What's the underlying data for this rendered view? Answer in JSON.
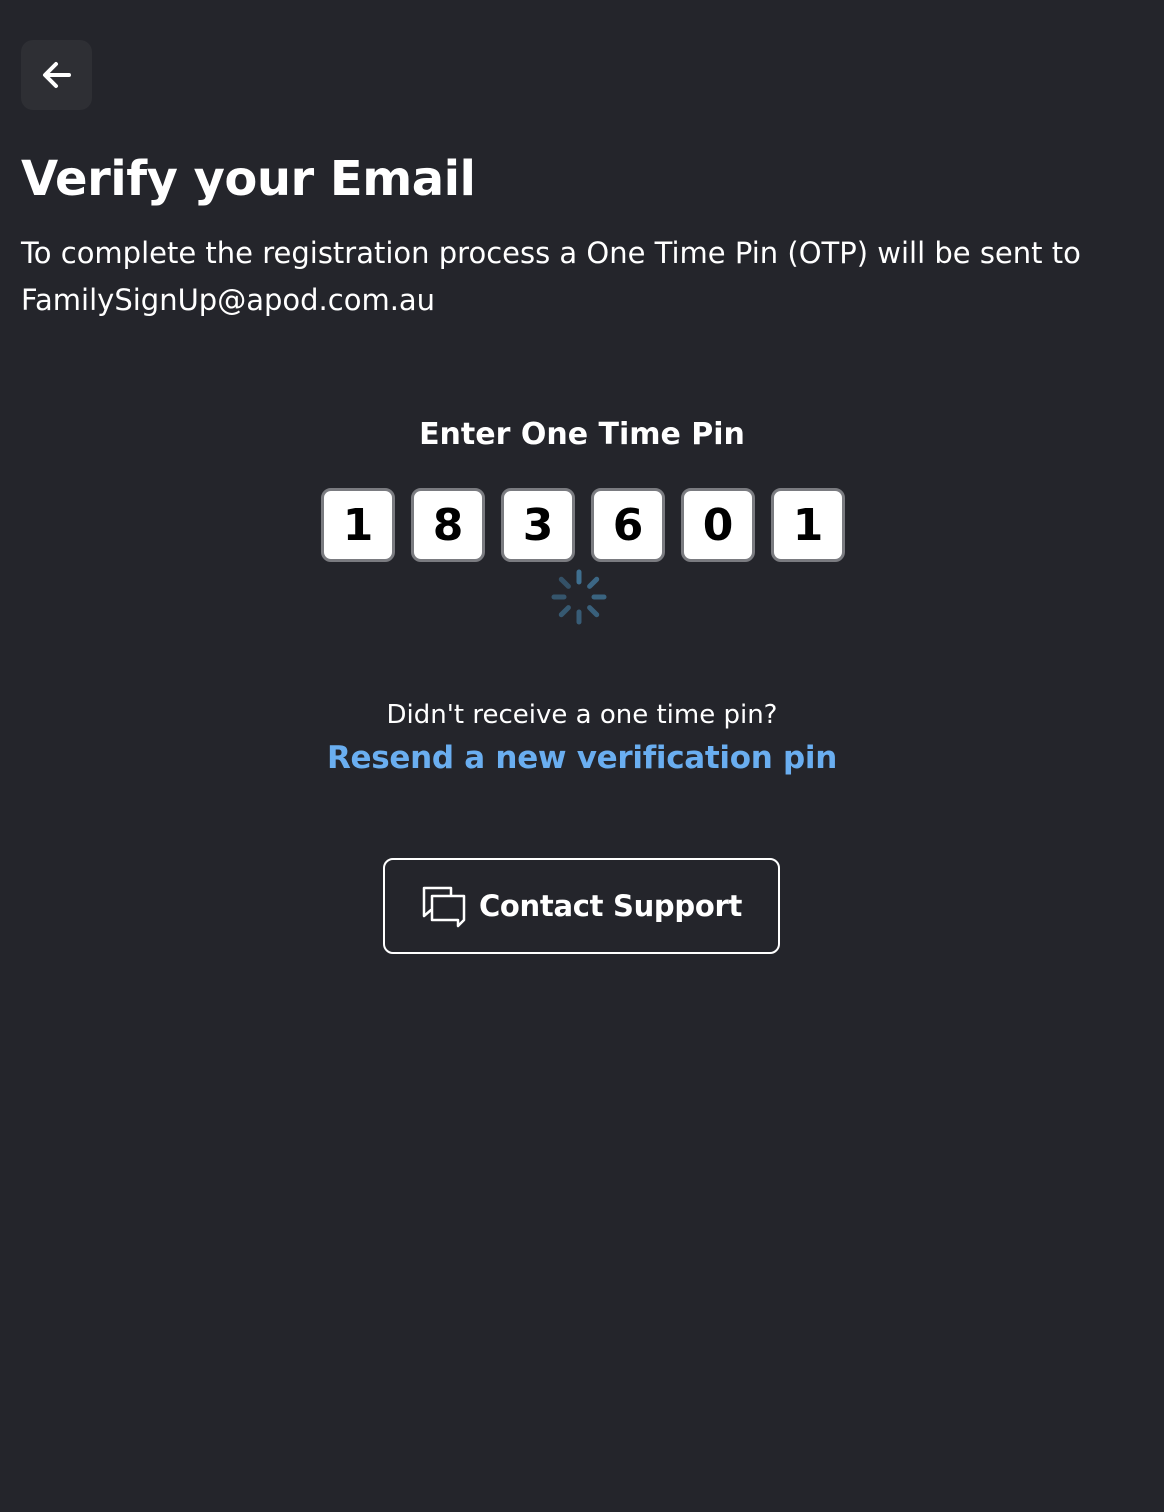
{
  "header": {
    "back_icon": "arrow-left-icon"
  },
  "title": "Verify your Email",
  "description": "To complete the registration process a One Time Pin (OTP) will be sent to FamilySignUp@apod.com.au",
  "otp": {
    "label": "Enter One Time Pin",
    "digits": [
      "1",
      "8",
      "3",
      "6",
      "0",
      "1"
    ]
  },
  "loading": {
    "icon": "loading-spinner-icon",
    "color": "#3f6f8f"
  },
  "resend": {
    "prompt": "Didn't receive a one time pin?",
    "link_label": "Resend a new verification pin",
    "link_color": "#6aaef0"
  },
  "support": {
    "icon": "chat-bubbles-icon",
    "label": "Contact Support"
  },
  "colors": {
    "background": "#24252b",
    "back_button_bg": "#2e2f34"
  }
}
